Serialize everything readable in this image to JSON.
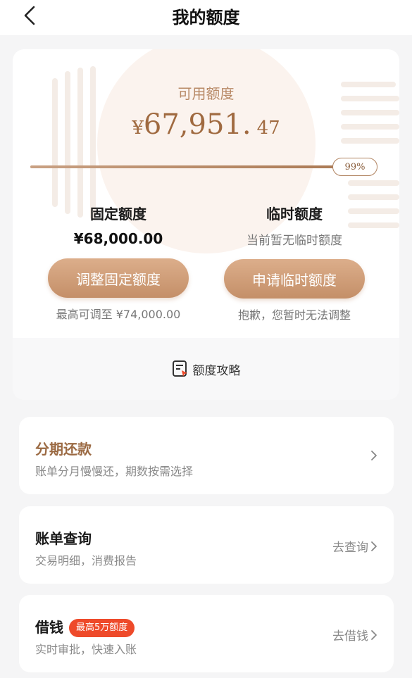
{
  "header": {
    "title": "我的额度",
    "back_icon": "chevron-left-icon"
  },
  "quota": {
    "available_label": "可用额度",
    "currency_symbol": "¥",
    "available_integer": "67,951.",
    "available_decimal": "47",
    "usage_percent_text": "99%",
    "usage_fraction": 0.99,
    "fixed": {
      "title": "固定额度",
      "value": "¥68,000.00",
      "button_label": "调整固定额度",
      "note": "最高可调至 ¥74,000.00"
    },
    "temporary": {
      "title": "临时额度",
      "value": "当前暂无临时额度",
      "button_label": "申请临时额度",
      "note": "抱歉，您暂时无法调整"
    },
    "strategy_label": "额度攻略"
  },
  "rows": [
    {
      "title": "分期还款",
      "subtitle": "账单分月慢慢还，期数按需选择",
      "action": ""
    },
    {
      "title": "账单查询",
      "subtitle": "交易明细，消费报告",
      "action": "去查询"
    },
    {
      "title": "借钱",
      "badge": "最高5万额度",
      "subtitle": "实时审批，快速入账",
      "action": "去借钱"
    }
  ],
  "colors": {
    "accent_brown": "#a06a40",
    "button_gradient_top": "#dcae8b",
    "button_gradient_bottom": "#c48f68",
    "badge_red": "#ee4a2a"
  }
}
